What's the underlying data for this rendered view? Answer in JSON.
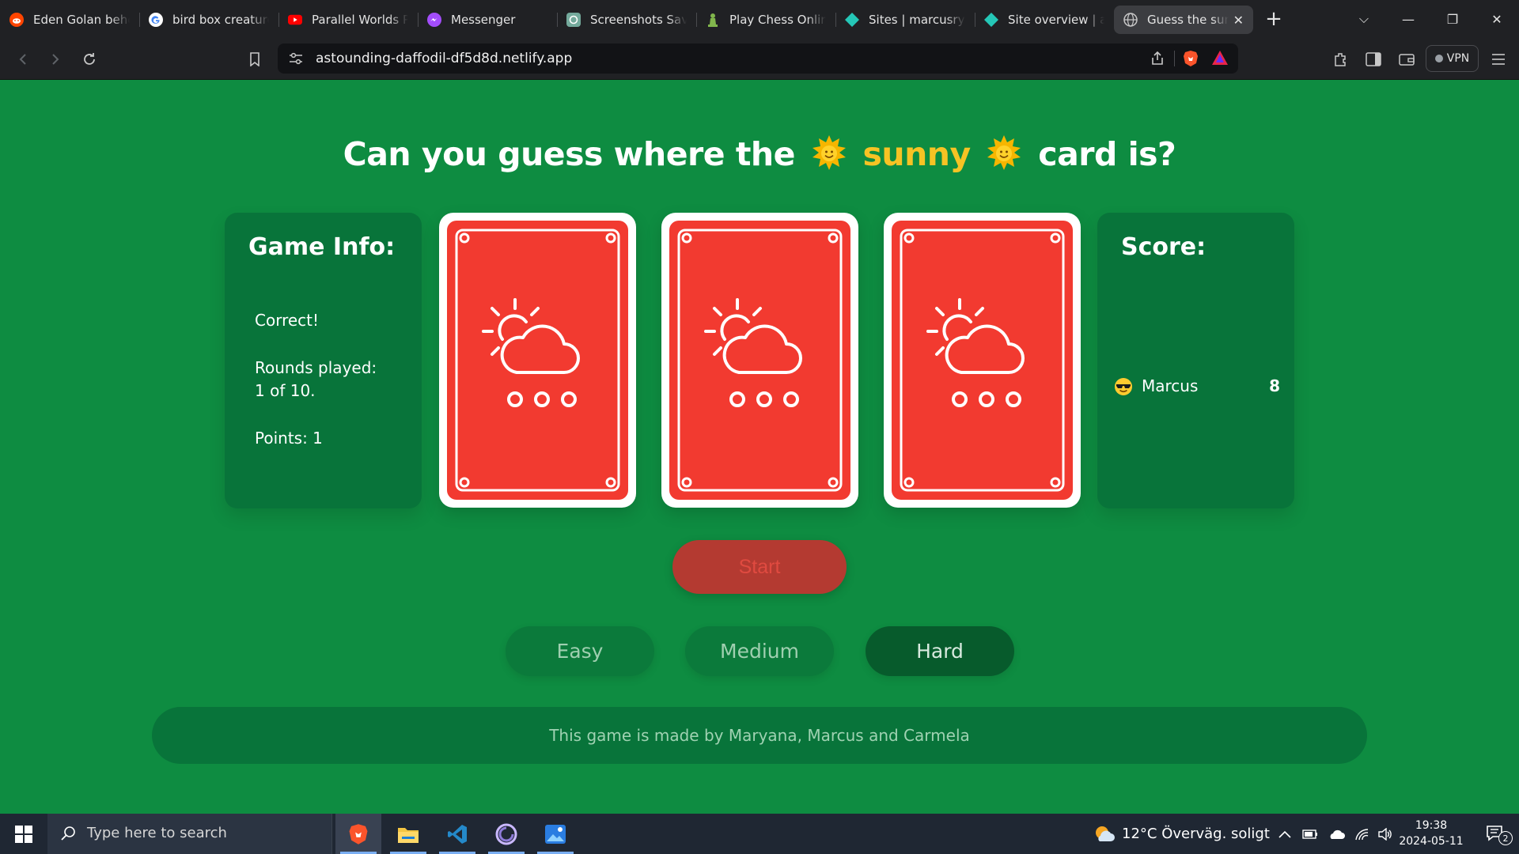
{
  "browser": {
    "tabs": [
      {
        "title": "Eden Golan behöv",
        "icon": "reddit-icon"
      },
      {
        "title": "bird box creatures",
        "icon": "google-icon"
      },
      {
        "title": "Parallel Worlds Pro",
        "icon": "youtube-icon"
      },
      {
        "title": "Messenger",
        "icon": "messenger-icon"
      },
      {
        "title": "Screenshots Saved",
        "icon": "chatgpt-icon"
      },
      {
        "title": "Play Chess Online",
        "icon": "chess-icon"
      },
      {
        "title": "Sites | marcusryde",
        "icon": "netlify-icon"
      },
      {
        "title": "Site overview | ast",
        "icon": "netlify-icon"
      },
      {
        "title": "Guess the sunny",
        "icon": "globe-icon",
        "active": true
      }
    ],
    "url": "astounding-daffodil-df5d8d.netlify.app",
    "vpn_label": "VPN"
  },
  "page": {
    "heading_pre": "Can you guess where the",
    "heading_word": "sunny",
    "heading_post": "card is?",
    "game_info": {
      "title": "Game Info:",
      "status": "Correct!",
      "rounds_label": "Rounds played:",
      "rounds_value": "1 of 10.",
      "points": "Points: 1"
    },
    "score": {
      "title": "Score:",
      "players": [
        {
          "name": "Marcus",
          "score": "8",
          "icon": "sunglasses-emoji-icon"
        }
      ]
    },
    "cards": [
      {
        "icon": "sun-cloud-snow-icon",
        "face": "back"
      },
      {
        "icon": "sun-cloud-snow-icon",
        "face": "back"
      },
      {
        "icon": "sun-cloud-snow-icon",
        "face": "back"
      }
    ],
    "start_label": "Start",
    "difficulty": [
      {
        "label": "Easy",
        "selected": false
      },
      {
        "label": "Medium",
        "selected": false
      },
      {
        "label": "Hard",
        "selected": true
      }
    ],
    "footer": "This game is made by Maryana, Marcus and Carmela"
  },
  "taskbar": {
    "search_placeholder": "Type here to search",
    "apps": [
      "brave-icon",
      "file-explorer-icon",
      "vscode-icon",
      "app-swirl-icon",
      "photos-icon"
    ],
    "weather": "12°C  Överväg. soligt",
    "time": "19:38",
    "date": "2024-05-11",
    "notifications": "2"
  },
  "colors": {
    "page_bg": "#0e8c41",
    "panel_bg": "#08743a",
    "card_red": "#f23a30",
    "accent_yellow": "#f6c324",
    "start_bg": "#b43a31"
  }
}
